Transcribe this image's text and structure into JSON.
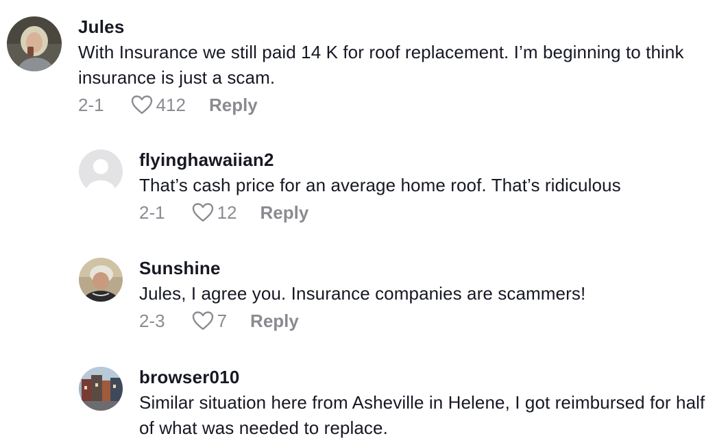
{
  "comments": [
    {
      "username": "Jules",
      "text": "With Insurance we still paid 14 K for roof replacement. I’m beginning to think insurance is just a scam.",
      "date": "2-1",
      "likes": "412",
      "reply_label": "Reply",
      "avatar_icon": "user-photo-avatar"
    }
  ],
  "replies": [
    {
      "username": "flyinghawaiian2",
      "text": "That’s cash price for an average home roof. That’s ridiculous",
      "date": "2-1",
      "likes": "12",
      "reply_label": "Reply",
      "avatar_icon": "default-avatar-icon"
    },
    {
      "username": "Sunshine",
      "text": "Jules, I agree you. Insurance companies are scammers!",
      "date": "2-3",
      "likes": "7",
      "reply_label": "Reply",
      "avatar_icon": "user-photo-avatar"
    },
    {
      "username": "browser010",
      "text": "Similar situation here from Asheville in Helene, I got reimbursed for half of what was needed to replace.",
      "date": "",
      "likes": "",
      "reply_label": "",
      "avatar_icon": "user-photo-avatar"
    }
  ],
  "colors": {
    "text_primary": "#161823",
    "text_secondary": "#8a8b91",
    "default_avatar_bg": "#e3e3e6"
  }
}
